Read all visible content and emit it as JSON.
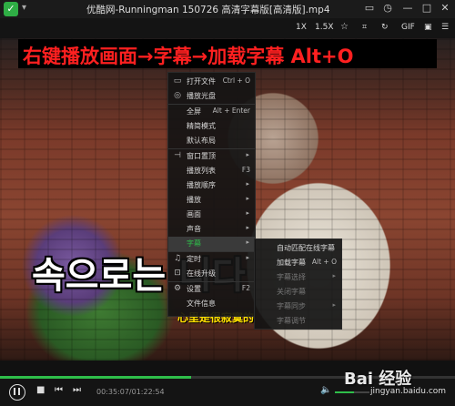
{
  "window": {
    "title": "优酷网-Runningman 150726 高清字幕版[高清版].mp4",
    "logo": "✓",
    "logo_dropdown": "▾"
  },
  "window_controls": [
    {
      "name": "mini-mode-icon",
      "glyph": "▭"
    },
    {
      "name": "history-icon",
      "glyph": "◷"
    },
    {
      "name": "minimize-icon",
      "glyph": "—"
    },
    {
      "name": "maximize-icon",
      "glyph": "□"
    },
    {
      "name": "close-icon",
      "glyph": "✕"
    }
  ],
  "toolbar": {
    "speed1": "1X",
    "speed2": "1.5X",
    "gif": "GIF"
  },
  "video": {
    "banner": "右键播放画面→字幕→加载字幕 Alt+O",
    "subtitle_korean": "속으로는           니다",
    "subtitle_chinese": "心里是很寂寞的"
  },
  "context_menu": {
    "items": [
      {
        "icon": "folder-icon",
        "glyph": "▭",
        "label": "打开文件",
        "shortcut": "Ctrl + O"
      },
      {
        "icon": "disc-icon",
        "glyph": "◎",
        "label": "播放光盘",
        "shortcut": ""
      },
      {
        "icon": "",
        "glyph": "",
        "label": "全屏",
        "shortcut": "Alt + Enter"
      },
      {
        "icon": "",
        "glyph": "",
        "label": "精简模式",
        "shortcut": ""
      },
      {
        "icon": "",
        "glyph": "",
        "label": "默认布局",
        "shortcut": ""
      },
      {
        "icon": "pin-icon",
        "glyph": "⊣",
        "label": "窗口置顶",
        "shortcut": "",
        "arrow": "▸"
      },
      {
        "icon": "",
        "glyph": "",
        "label": "播放列表",
        "shortcut": "F3"
      },
      {
        "icon": "",
        "glyph": "",
        "label": "播放顺序",
        "shortcut": "",
        "arrow": "▸"
      },
      {
        "icon": "",
        "glyph": "",
        "label": "播放",
        "shortcut": "",
        "arrow": "▸"
      },
      {
        "icon": "",
        "glyph": "",
        "label": "画面",
        "shortcut": "",
        "arrow": "▸"
      },
      {
        "icon": "",
        "glyph": "",
        "label": "声音",
        "shortcut": "",
        "arrow": "▸"
      },
      {
        "icon": "",
        "glyph": "",
        "label": "字幕",
        "shortcut": "",
        "arrow": "▸",
        "selected": true
      },
      {
        "icon": "bell-icon",
        "glyph": "♫",
        "label": "定时",
        "shortcut": "",
        "arrow": "▸"
      },
      {
        "icon": "upgrade-icon",
        "glyph": "⊡",
        "label": "在线升级",
        "shortcut": ""
      },
      {
        "icon": "gear-icon",
        "glyph": "⚙",
        "label": "设置",
        "shortcut": "F2"
      },
      {
        "icon": "",
        "glyph": "",
        "label": "文件信息",
        "shortcut": ""
      }
    ]
  },
  "subtitle_menu": {
    "items": [
      {
        "label": "自动匹配在线字幕",
        "shortcut": "",
        "disabled": false
      },
      {
        "label": "加载字幕",
        "shortcut": "Alt + O",
        "disabled": false
      },
      {
        "label": "字幕选择",
        "shortcut": "",
        "disabled": true,
        "arrow": "▸"
      },
      {
        "label": "关闭字幕",
        "shortcut": "",
        "disabled": true
      },
      {
        "label": "字幕同步",
        "shortcut": "",
        "disabled": true,
        "arrow": "▸"
      },
      {
        "label": "字幕调节",
        "shortcut": "",
        "disabled": true
      }
    ]
  },
  "playback": {
    "time": "00:35:07/01:22:54",
    "progress_fraction": 0.42,
    "volume_fraction": 0.55
  },
  "watermark": {
    "brand": "Bai 经验",
    "url": "jingyan.baidu.com"
  }
}
